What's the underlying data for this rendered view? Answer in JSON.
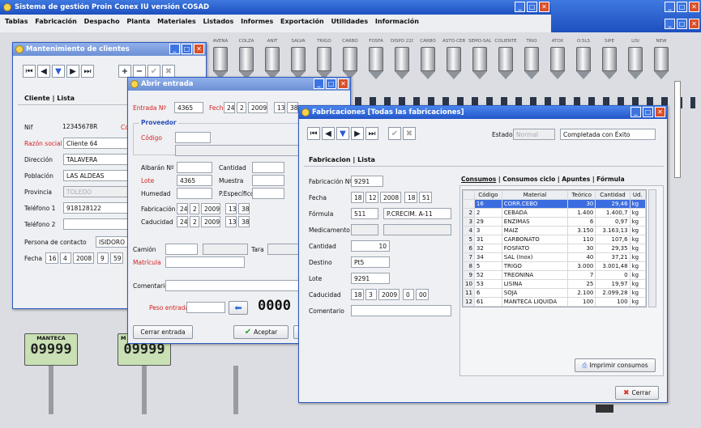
{
  "main": {
    "title": "Sistema de gestión Proin Conex IU versión COSAD",
    "menu": [
      "Tablas",
      "Fabricación",
      "Despacho",
      "Planta",
      "Materiales",
      "Listados",
      "Informes",
      "Exportación",
      "Utilidades",
      "Información"
    ]
  },
  "silos": [
    "AVENA",
    "COLZA",
    "ANIT",
    "SALVA",
    "TRIGO",
    "CARBO",
    "FOSFA",
    "DISPO 220",
    "CARBO",
    "ASTO-CEBO 210",
    "SEMO-SAL",
    "COLIENTE",
    "TRIO",
    "ATOX",
    "O.5LS",
    "SIPE",
    "LISI",
    "NEW"
  ],
  "scales": [
    {
      "label": "MANTECA",
      "value": "09999"
    },
    {
      "label": "M",
      "value": "09999"
    }
  ],
  "clientes": {
    "title": "Mantenimiento de clientes",
    "tabs": [
      "Cliente",
      "Lista"
    ],
    "nif_label": "Nif",
    "nif": "12345678R",
    "razon_label": "Razón social",
    "razon": "Cliente 64",
    "direccion_label": "Dirección",
    "direccion": "TALAVERA",
    "poblacion_label": "Población",
    "poblacion": "LAS ALDEAS",
    "provincia_label": "Provincia",
    "provincia": "TOLEDO",
    "tel1_label": "Teléfono 1",
    "tel1": "918128122",
    "tel2_label": "Teléfono 2",
    "tel2": "",
    "contacto_label": "Persona de contacto",
    "contacto": "ISIDORO",
    "fecha_label": "Fecha",
    "fecha": [
      "16",
      "4",
      "2008",
      "9",
      "59"
    ],
    "cropped_label": "Cc"
  },
  "entrada": {
    "title": "Abrir entrada",
    "entrada_label": "Entrada Nº",
    "entrada": "4365",
    "fecha_label": "Fecha",
    "fecha": [
      "24",
      "2",
      "2009",
      "13",
      "38"
    ],
    "proveedor_label": "Proveedor",
    "codigo_label": "Código",
    "albaran_label": "Albarán Nº",
    "cantidad_label": "Cantidad",
    "lote_label": "Lote",
    "lote": "4365",
    "muestra_label": "Muestra",
    "humedad_label": "Humedad",
    "pespecifico_label": "P.Específico",
    "fabricacion_label": "Fabricación",
    "fabricacion": [
      "24",
      "2",
      "2009",
      "13",
      "38"
    ],
    "caducidad_label": "Caducidad",
    "caducidad": [
      "24",
      "2",
      "2009",
      "13",
      "38"
    ],
    "camion_label": "Camión",
    "tara_label": "Tara",
    "matricula_label": "Matrícula",
    "comentario_label": "Comentario",
    "peso_label": "Peso entrada",
    "peso_display": "0000",
    "cerrar_label": "Cerrar entrada",
    "aceptar_label": "Aceptar"
  },
  "fabricaciones": {
    "title": "Fabricaciones [Todas las fabricaciones]",
    "estado_label": "Estado",
    "estado_select": "Normal",
    "estado_text": "Completada con Éxito",
    "tabs": [
      "Fabricacion",
      "Lista"
    ],
    "fab_label": "Fabricación Nº",
    "fab": "9291",
    "fecha_label": "Fecha",
    "fecha": [
      "18",
      "12",
      "2008",
      "18",
      "51"
    ],
    "formula_label": "Fórmula",
    "formula_code": "511",
    "formula_name": "P.CRECIM. A-11",
    "medicamento_label": "Medicamento",
    "cantidad_label": "Cantidad",
    "cantidad": "10",
    "destino_label": "Destino",
    "destino": "Pt5",
    "lote_label": "Lote",
    "lote": "9291",
    "caducidad_label": "Caducidad",
    "caducidad": [
      "18",
      "3",
      "2009",
      "0",
      "00"
    ],
    "comentario_label": "Comentario",
    "subtabs": [
      "Consumos",
      "Consumos ciclo",
      "Apuntes",
      "Fórmula"
    ],
    "columns": [
      "Código",
      "Material",
      "Teórico",
      "Cantidad",
      "Ud."
    ],
    "rows": [
      [
        "1",
        "16",
        "CORR.CEBO",
        "30",
        "29,46",
        "kg"
      ],
      [
        "2",
        "2",
        "CEBADA",
        "1.400",
        "1.400,7",
        "kg"
      ],
      [
        "3",
        "29",
        "ENZIMAS",
        "6",
        "0,97",
        "kg"
      ],
      [
        "4",
        "3",
        "MAIZ",
        "3.150",
        "3.163,13",
        "kg"
      ],
      [
        "5",
        "31",
        "CARBONATO",
        "110",
        "107,6",
        "kg"
      ],
      [
        "6",
        "32",
        "FOSFATO",
        "30",
        "29,35",
        "kg"
      ],
      [
        "7",
        "34",
        "SAL (Inox)",
        "40",
        "37,21",
        "kg"
      ],
      [
        "8",
        "5",
        "TRIGO",
        "3.000",
        "3.001,48",
        "kg"
      ],
      [
        "9",
        "52",
        "TREONINA",
        "7",
        "0",
        "kg"
      ],
      [
        "10",
        "53",
        "LISINA",
        "25",
        "19,97",
        "kg"
      ],
      [
        "11",
        "6",
        "SOJA",
        "2.100",
        "2.099,28",
        "kg"
      ],
      [
        "12",
        "61",
        "MANTECA LIQUIDA",
        "100",
        "100",
        "kg"
      ]
    ],
    "imprimir_label": "Imprimir consumos",
    "cerrar_label": "Cerrar"
  }
}
